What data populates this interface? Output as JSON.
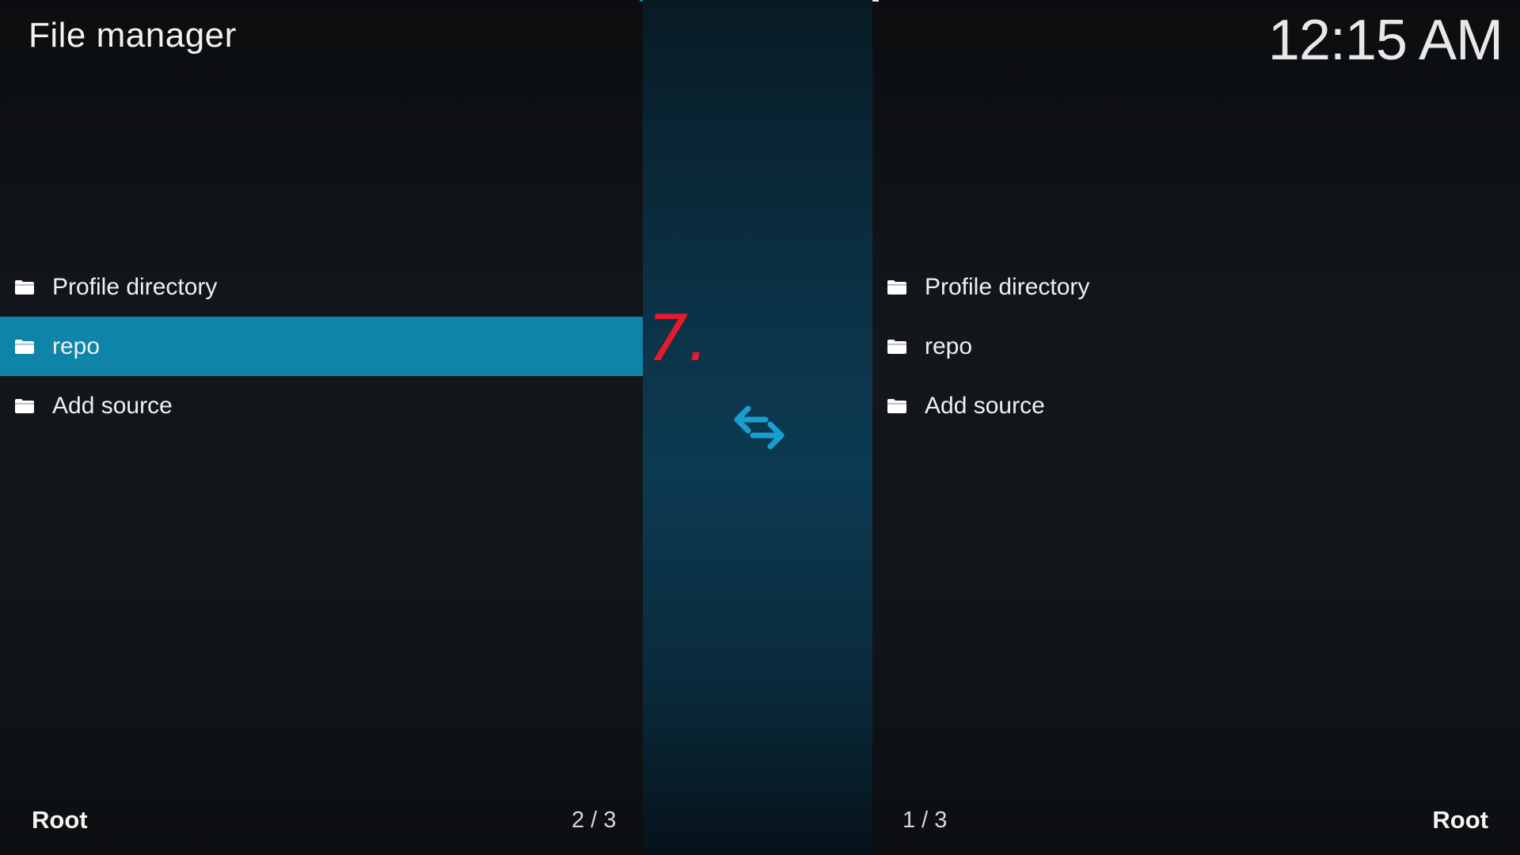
{
  "header": {
    "title": "File manager",
    "clock": "12:15 AM"
  },
  "left_pane": {
    "items": [
      {
        "label": "Profile directory",
        "icon": "folder-icon"
      },
      {
        "label": "repo",
        "icon": "folder-icon"
      },
      {
        "label": "Add source",
        "icon": "folder-icon"
      }
    ],
    "focused_index": 1,
    "footer_label": "Root",
    "position": "2 / 3"
  },
  "right_pane": {
    "items": [
      {
        "label": "Profile directory",
        "icon": "folder-icon"
      },
      {
        "label": "repo",
        "icon": "folder-icon"
      },
      {
        "label": "Add source",
        "icon": "folder-icon"
      }
    ],
    "footer_label": "Root",
    "position": "1 / 3"
  },
  "center": {
    "icon": "swap-arrows-icon",
    "annotation": "7."
  },
  "colors": {
    "accent": "#0e84a8",
    "annotation": "#e8192c",
    "swap_icon": "#1a9dd0"
  }
}
